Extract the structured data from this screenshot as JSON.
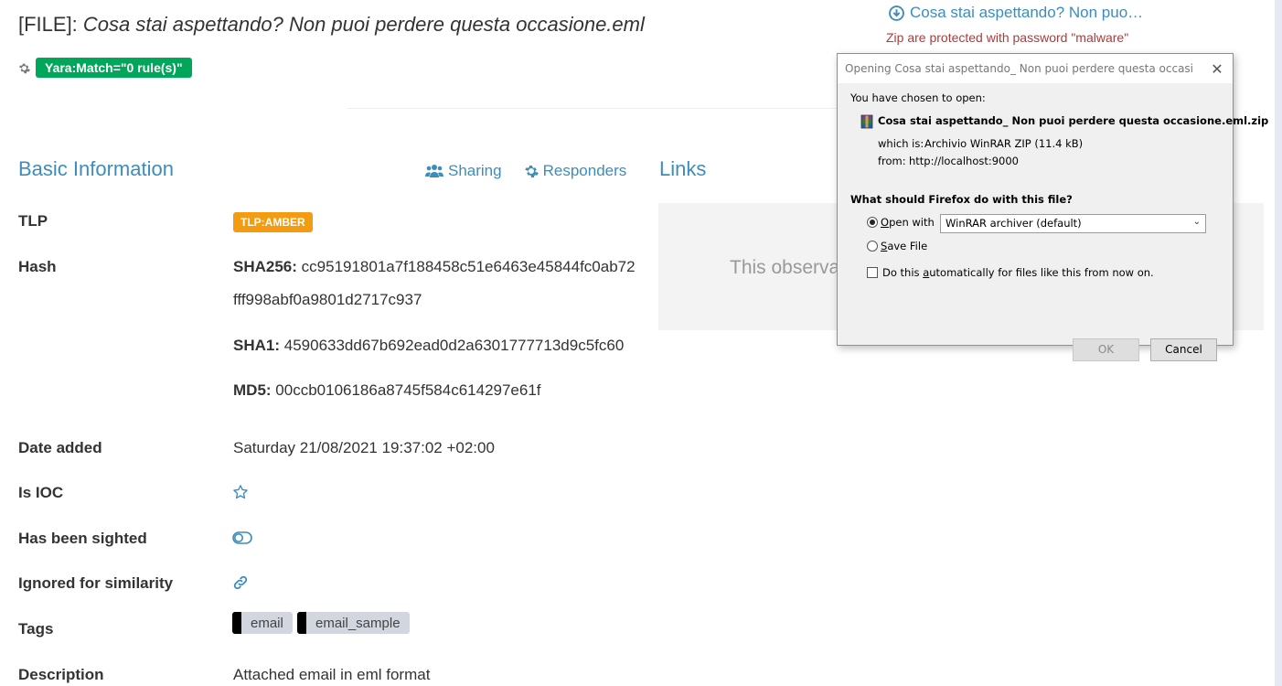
{
  "header": {
    "prefix": "[FILE]: ",
    "filename": "Cosa stai aspettando? Non puoi perdere questa occasione.eml",
    "yara_badge": "Yara:Match=\"0 rule(s)\""
  },
  "download": {
    "link_text": "Cosa stai aspettando? Non puo…",
    "zip_note": "Zip are protected with password \"malware\""
  },
  "basic_info": {
    "title": "Basic Information",
    "actions": {
      "sharing": "Sharing",
      "responders": "Responders"
    },
    "tlp": {
      "label": "TLP",
      "value": "TLP:AMBER",
      "color": "#f39c12"
    },
    "hash": {
      "label": "Hash",
      "sha256_label": "SHA256:",
      "sha256_line1": "cc95191801a7f188458c51e6463e45844fc0ab72",
      "sha256_line2": "fff998abf0a9801d2717c937",
      "sha1_label": "SHA1:",
      "sha1": "4590633dd67b692ead0d2a6301777713d9c5fc60",
      "md5_label": "MD5:",
      "md5": "00ccb0106186a8745f584c614297e61f"
    },
    "date_added": {
      "label": "Date added",
      "value": "Saturday 21/08/2021 19:37:02 +02:00"
    },
    "is_ioc": {
      "label": "Is IOC",
      "icon": "star-outline-icon"
    },
    "sighted": {
      "label": "Has been sighted",
      "icon": "toggle-off-icon"
    },
    "ignored": {
      "label": "Ignored for similarity",
      "icon": "chain-link-icon"
    },
    "tags": {
      "label": "Tags",
      "items": [
        "email",
        "email_sample"
      ]
    },
    "description": {
      "label": "Description",
      "value": "Attached email in eml format"
    }
  },
  "links": {
    "title": "Links",
    "empty_text": "This observa"
  },
  "dialog": {
    "title": "Opening Cosa stai aspettando_ Non puoi perdere questa occasione.eml....",
    "chosen": "You have chosen to open:",
    "file": "Cosa stai aspettando_ Non puoi perdere questa occasione.eml.zip",
    "which_is_label": "which is:",
    "which_is_value": "Archivio WinRAR ZIP (11.4 kB)",
    "from_label": "from:",
    "from_value": "http://localhost:9000",
    "question": "What should Firefox do with this file?",
    "open_with_key": "O",
    "open_with_rest": "pen with",
    "open_with_app": "WinRAR archiver (default)",
    "save_key": "S",
    "save_rest": "ave File",
    "auto_pre": "Do this ",
    "auto_key": "a",
    "auto_rest": "utomatically for files like this from now on.",
    "ok": "OK",
    "cancel": "Cancel"
  }
}
